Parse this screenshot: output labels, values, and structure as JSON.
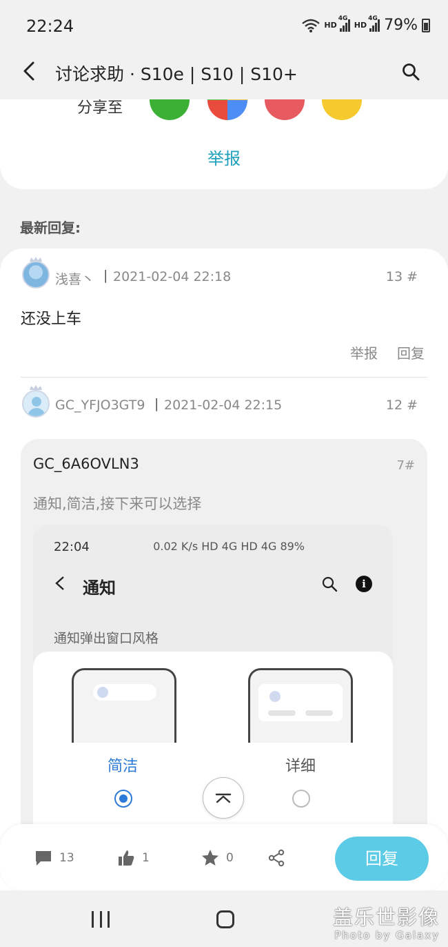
{
  "status_bar": {
    "time": "22:24",
    "battery": "79%",
    "network": "HD",
    "network_gen": "4G"
  },
  "app_bar": {
    "title": "讨论求助 · S10e | S10 | S10+"
  },
  "share_card": {
    "label": "分享至",
    "targets": [
      "wechat-icon",
      "moments-icon",
      "weibo-icon",
      "qzone-icon"
    ],
    "report": "举报"
  },
  "section_label": "最新回复:",
  "replies": [
    {
      "user": "浅喜丶",
      "separator": "|",
      "date": "2021-02-04 22:18",
      "floor": "13 #",
      "text": "还没上车",
      "report": "举报",
      "reply": "回复"
    },
    {
      "user": "GC_YFJO3GT9",
      "separator": "|",
      "date": "2021-02-04 22:15",
      "floor": "12 #",
      "quote": {
        "user": "GC_6A6OVLN3",
        "floor": "7#",
        "text": "通知,简洁,接下来可以选择",
        "screenshot": {
          "time": "22:04",
          "status": "0.02 K/s  HD 4G  HD 4G  89%",
          "title": "通知",
          "section": "通知弹出窗口风格",
          "options": [
            {
              "label": "简洁",
              "selected": true
            },
            {
              "label": "详细",
              "selected": false
            }
          ]
        }
      }
    }
  ],
  "bottom_bar": {
    "comments": "13",
    "likes": "1",
    "favorites": "0",
    "reply_button": "回复"
  },
  "watermark": {
    "main": "盖乐世影像",
    "sub": "Photo by Galaxy"
  },
  "colors": {
    "accent": "#1ea0bd",
    "reply_button": "#5ccbe6",
    "radio_selected": "#2c79d6",
    "background": "#f1f1f1"
  }
}
